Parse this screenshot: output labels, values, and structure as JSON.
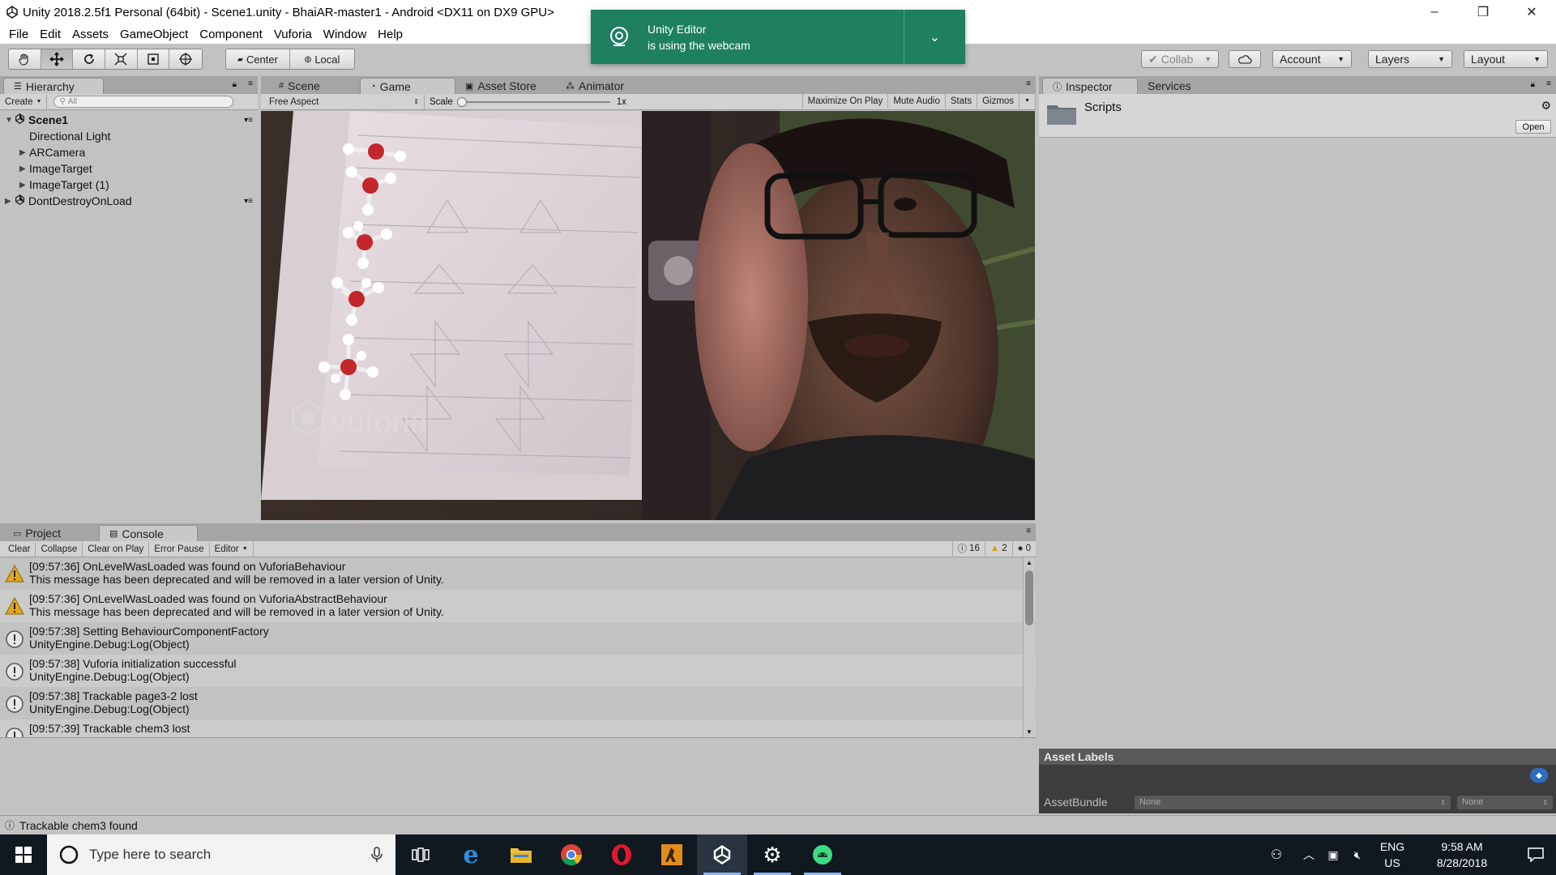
{
  "window": {
    "title": "Unity 2018.2.5f1 Personal (64bit) - Scene1.unity - BhaiAR-master1 - Android <DX11 on DX9 GPU>",
    "controls": [
      "–",
      "❐",
      "✕"
    ]
  },
  "menu": [
    "File",
    "Edit",
    "Assets",
    "GameObject",
    "Component",
    "Vuforia",
    "Window",
    "Help"
  ],
  "toolbar": {
    "pivot": "Center",
    "space": "Local",
    "collab": "Collab",
    "account": "Account",
    "layers": "Layers",
    "layout": "Layout"
  },
  "notification": {
    "title": "Unity Editor",
    "message": "is using the webcam"
  },
  "hierarchy": {
    "tab": "Hierarchy",
    "create": "Create",
    "search_placeholder": "All",
    "scene": "Scene1",
    "items": [
      "Directional Light",
      "ARCamera",
      "ImageTarget",
      "ImageTarget (1)"
    ],
    "dontdestroy": "DontDestroyOnLoad"
  },
  "game": {
    "tabs": [
      "Scene",
      "Game",
      "Asset Store",
      "Animator"
    ],
    "aspect": "Free Aspect",
    "scale_label": "Scale",
    "scale_value": "1x",
    "buttons": [
      "Maximize On Play",
      "Mute Audio",
      "Stats",
      "Gizmos"
    ],
    "watermark": "vuforia"
  },
  "inspector": {
    "tabs": [
      "Inspector",
      "Services"
    ],
    "object_name": "Scripts",
    "open_button": "Open",
    "asset_labels": "Asset Labels",
    "assetbundle_label": "AssetBundle",
    "assetbundle_value": "None",
    "variant_value": "None"
  },
  "console": {
    "tabs": [
      "Project",
      "Console"
    ],
    "buttons": [
      "Clear",
      "Collapse",
      "Clear on Play",
      "Error Pause",
      "Editor"
    ],
    "counts": {
      "info": "16",
      "warn": "2",
      "error": "0"
    },
    "entries": [
      {
        "type": "warn",
        "line1": "[09:57:36] OnLevelWasLoaded was found on VuforiaBehaviour",
        "line2": "This message has been deprecated and will be removed in a later version of Unity."
      },
      {
        "type": "warn",
        "line1": "[09:57:36] OnLevelWasLoaded was found on VuforiaAbstractBehaviour",
        "line2": "This message has been deprecated and will be removed in a later version of Unity."
      },
      {
        "type": "info",
        "line1": "[09:57:38] Setting BehaviourComponentFactory",
        "line2": "UnityEngine.Debug:Log(Object)"
      },
      {
        "type": "info",
        "line1": "[09:57:38] Vuforia initialization successful",
        "line2": "UnityEngine.Debug:Log(Object)"
      },
      {
        "type": "info",
        "line1": "[09:57:38] Trackable page3-2 lost",
        "line2": "UnityEngine.Debug:Log(Object)"
      },
      {
        "type": "info",
        "line1": "[09:57:39] Trackable chem3 lost",
        "line2": ""
      }
    ]
  },
  "status": "Trackable chem3 found",
  "taskbar": {
    "search_placeholder": "Type here to search",
    "lang1": "ENG",
    "lang2": "US",
    "time": "9:58 AM",
    "date": "8/28/2018"
  }
}
